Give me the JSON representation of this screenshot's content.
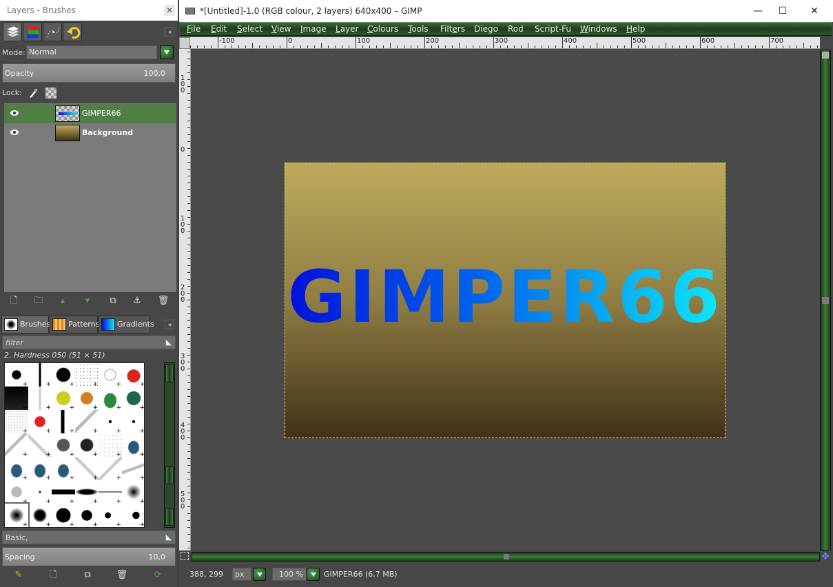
{
  "dock": {
    "title": "Layers - Brushes",
    "close_glyph": "✕",
    "mode_label": "Mode:",
    "mode_value": "Normal",
    "opacity_label": "Opacity",
    "opacity_value": "100,0",
    "opacity_fraction": 1.0,
    "lock_label": "Lock:",
    "layers": [
      {
        "name": "GIMPER66",
        "selected": true,
        "bold": false
      },
      {
        "name": "Background",
        "selected": false,
        "bold": true
      }
    ],
    "brush_tabs": [
      "Brushes",
      "Patterns",
      "Gradients"
    ],
    "filter_placeholder": "filter",
    "brush_name": "2. Hardness 050 (51 × 51)",
    "tag_value": "Basic,",
    "spacing_label": "Spacing",
    "spacing_value": "10,0"
  },
  "main": {
    "title": "*[Untitled]-1.0 (RGB colour, 2 layers) 640x400 – GIMP",
    "window_controls": [
      "—",
      "☐",
      "✕"
    ],
    "menu": [
      {
        "pre": "",
        "u": "F",
        "post": "ile"
      },
      {
        "pre": "",
        "u": "E",
        "post": "dit"
      },
      {
        "pre": "",
        "u": "S",
        "post": "elect"
      },
      {
        "pre": "",
        "u": "V",
        "post": "iew"
      },
      {
        "pre": "",
        "u": "I",
        "post": "mage"
      },
      {
        "pre": "",
        "u": "L",
        "post": "ayer"
      },
      {
        "pre": "",
        "u": "C",
        "post": "olours"
      },
      {
        "pre": "",
        "u": "T",
        "post": "ools"
      },
      {
        "pre": "Filt",
        "u": "e",
        "post": "rs"
      },
      {
        "pre": "Diego",
        "u": "",
        "post": ""
      },
      {
        "pre": "Rod",
        "u": "",
        "post": ""
      },
      {
        "pre": "Script-Fu",
        "u": "",
        "post": ""
      },
      {
        "pre": "",
        "u": "W",
        "post": "indows"
      },
      {
        "pre": "",
        "u": "H",
        "post": "elp"
      }
    ],
    "hruler_labels": [
      "-100",
      "0",
      "100",
      "200",
      "300",
      "400",
      "500",
      "600",
      "700"
    ],
    "vruler_labels": [
      "100",
      "0",
      "100",
      "200",
      "300",
      "400",
      "500"
    ],
    "image_text": "GIMPER66",
    "status": {
      "coords": "388, 299",
      "unit": "px",
      "zoom": "100 %",
      "message": "GIMPER66 (6,7 MB)"
    }
  },
  "colors": {
    "menubar_green": "#2f5a2b",
    "selected_layer": "#4f7f45",
    "text_gradient_start": "#0010dd",
    "text_gradient_end": "#10e8f8"
  }
}
